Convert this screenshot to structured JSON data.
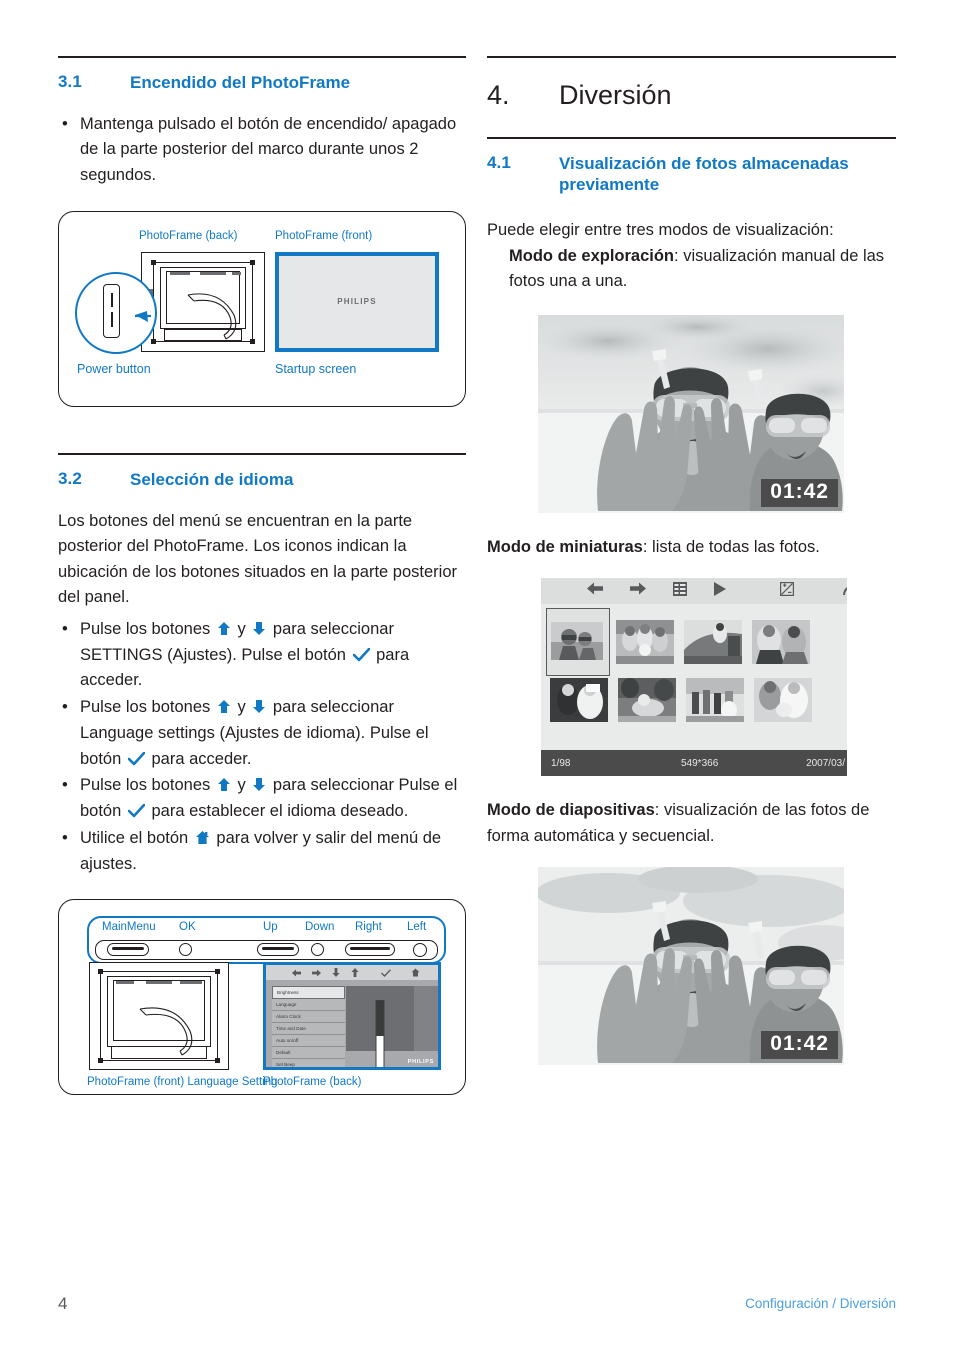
{
  "meta": {
    "accent_blue": "#1179c4",
    "text_color": "#231f20"
  },
  "left": {
    "section_31": {
      "num": "3.1",
      "title": "Encendido del PhotoFrame",
      "bullets": [
        "Mantenga pulsado el botón de encendido/ apagado de la parte posterior del marco durante unos 2 segundos."
      ]
    },
    "figure1": {
      "label_back": "PhotoFrame (back)",
      "label_front": "PhotoFrame (front)",
      "label_power": "Power button",
      "label_startup": "Startup screen",
      "brand": "PHILIPS"
    },
    "section_32": {
      "num": "3.2",
      "title": "Selección de idioma",
      "intro": "Los botones del menú se encuentran en la parte posterior del PhotoFrame. Los iconos indican la ubicación de los botones situados en la parte posterior del panel.",
      "b1_a": "Pulse los botones",
      "b1_y": "y",
      "b1_b": "para seleccionar SETTINGS (Ajustes). Pulse el botón",
      "b1_c": "para acceder.",
      "b2_a": "Pulse los botones",
      "b2_y": "y",
      "b2_b": "para seleccionar Language settings (Ajustes de idioma). Pulse el botón",
      "b2_c": "para acceder.",
      "b3_a": "Pulse los botones",
      "b3_y": "y",
      "b3_b": "para seleccionar Pulse el botón",
      "b3_c": "para establecer el idioma deseado.",
      "b4_a": "Utilice el botón",
      "b4_b": "para volver y salir del menú de ajustes."
    },
    "figure2": {
      "btn_mainmenu": "MainMenu",
      "btn_ok": "OK",
      "btn_up": "Up",
      "btn_down": "Down",
      "btn_right": "Right",
      "btn_left": "Left",
      "label_front": "PhotoFrame (front) Language Setting",
      "label_back": "PhotoFrame (back)",
      "brand": "PHILIPS",
      "menu_items": [
        "Brightness",
        "Language",
        "Alarm Clock",
        "Time and Date",
        "Auto on/off",
        "Default",
        "Set Beep"
      ]
    }
  },
  "right": {
    "chapter": {
      "num": "4.",
      "title": "Diversión"
    },
    "section_41": {
      "num": "4.1",
      "title": "Visualización de fotos almacenadas previamente"
    },
    "intro": "Puede elegir entre tres modos de visualización:",
    "mode1_label": "Modo de exploración",
    "mode1_text": ": visualización manual de las fotos una a una.",
    "mode2_label": "Modo de miniaturas",
    "mode2_text": ": lista de todas las fotos.",
    "mode3_label": "Modo de diapositivas",
    "mode3_text": ": visualización de las fotos de forma automática y secuencial.",
    "photo1": {
      "clock": "01:42"
    },
    "photo3": {
      "clock": "01:42"
    },
    "thumbnails": {
      "toolbar_icons": [
        "left-arrow-icon",
        "right-arrow-icon",
        "grid-icon",
        "play-icon",
        "brightness-icon",
        "back-arrow-icon"
      ],
      "status_left": "1/98",
      "status_center": "549*366",
      "status_right": "2007/03/"
    }
  },
  "footer": {
    "page_number": "4",
    "breadcrumb": "Configuración / Diversión"
  }
}
